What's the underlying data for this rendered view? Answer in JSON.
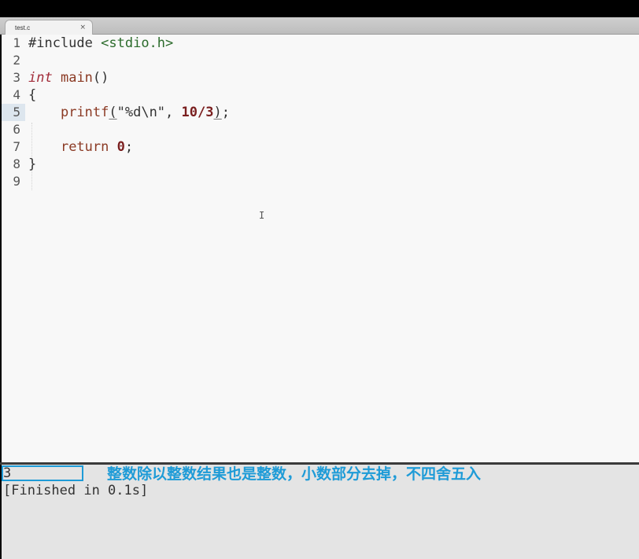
{
  "tab": {
    "label": "test.c",
    "close_glyph": "×"
  },
  "editor": {
    "line_numbers": [
      "1",
      "2",
      "3",
      "4",
      "5",
      "6",
      "7",
      "8",
      "9"
    ],
    "lines": {
      "l1_pre": "#include",
      "l1_hdr": "<stdio.h>",
      "l3_type": "int",
      "l3_fn": "main",
      "l3_paren": "()",
      "l4": "{",
      "l5_indent": "    ",
      "l5_fn": "printf",
      "l5_open": "(",
      "l5_str": "\"%d\\n\"",
      "l5_comma": ", ",
      "l5_num1": "10",
      "l5_op": "/",
      "l5_num2": "3",
      "l5_close": ")",
      "l5_semi": ";",
      "l7_indent": "    ",
      "l7_kw": "return",
      "l7_sp": " ",
      "l7_num": "0",
      "l7_semi": ";",
      "l8": "}"
    },
    "cursor_glyph": "I"
  },
  "output": {
    "result": "3",
    "finished": "[Finished in 0.1s]",
    "annotation": "整数除以整数结果也是整数，小数部分去掉，不四舍五入"
  },
  "colors": {
    "annotation": "#1e9bd7",
    "editor_bg": "#f8f8f8",
    "output_bg": "#e4e4e4"
  }
}
